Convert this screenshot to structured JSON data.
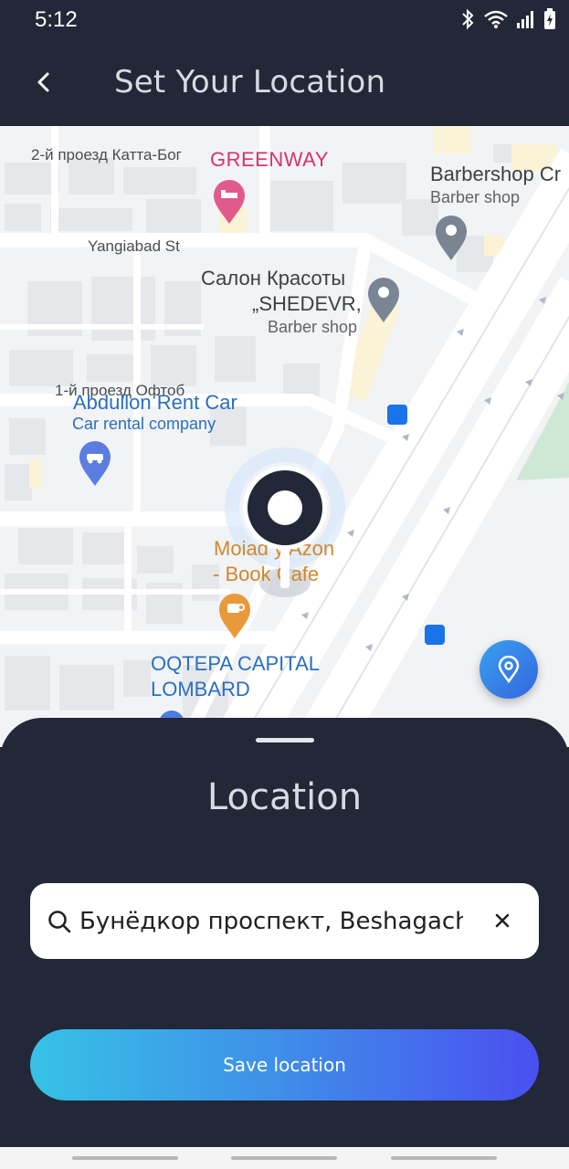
{
  "status_bar": {
    "time": "5:12"
  },
  "header": {
    "title": "Set Your Location"
  },
  "map": {
    "streets": [
      "2-й проезд Катта-Бог",
      "Yangiabad St",
      "1-й проезд Офтоб"
    ],
    "places": [
      {
        "name": "GREENWAY",
        "category": ""
      },
      {
        "name": "Barbershop Cr",
        "category": "Barber shop"
      },
      {
        "name": "Салон Красоты",
        "name2": "„SHEDEVR,",
        "category": "Barber shop"
      },
      {
        "name": "Abdullon Rent Car",
        "category": "Car rental company"
      },
      {
        "name": "Moiad  y Azon",
        "name2": "- Book Cafe"
      },
      {
        "name": "OQTEPA CAPITAL",
        "name2": "LOMBARD"
      }
    ],
    "accent_pink": "#d6336c",
    "accent_blue": "#2a6fc0",
    "accent_orange": "#d2872c"
  },
  "sheet": {
    "title": "Location",
    "search": {
      "value": "Бунёдкор проспект, Beshagach, S"
    },
    "save_label": "Save location"
  },
  "colors": {
    "background": "#232838",
    "button_start": "#36c2e6",
    "button_end": "#4a4ff0"
  }
}
